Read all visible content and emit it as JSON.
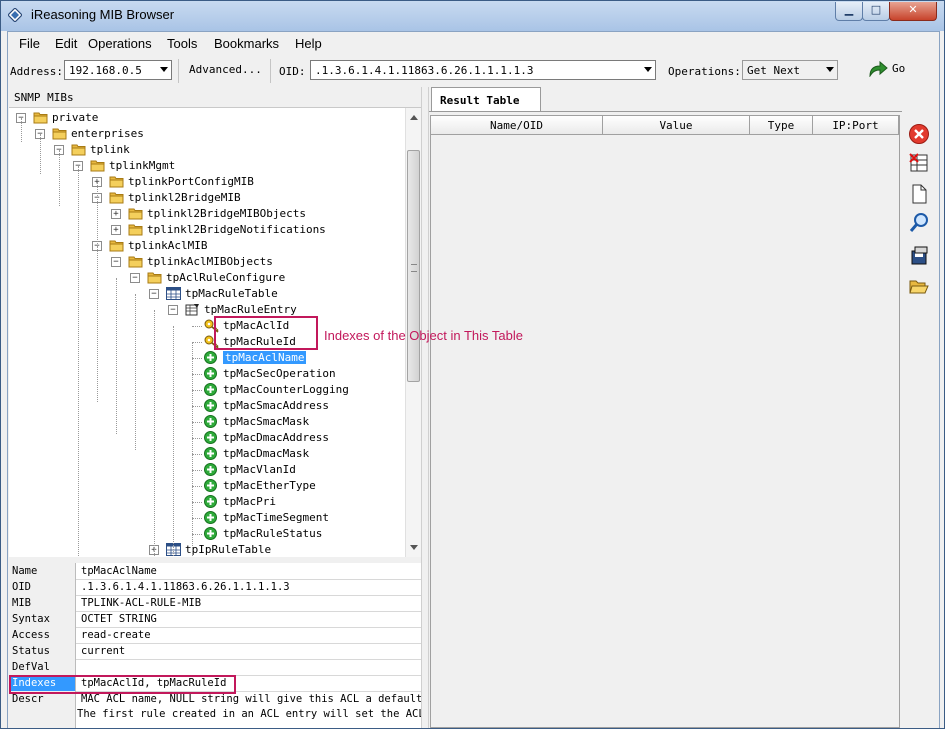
{
  "window": {
    "title": "iReasoning MIB Browser",
    "buttons": {
      "minimize": "▁",
      "maximize": "□",
      "close": "✕"
    }
  },
  "menu": [
    "File",
    "Edit",
    "Operations",
    "Tools",
    "Bookmarks",
    "Help"
  ],
  "toolbar": {
    "address_label": "Address:",
    "address_value": "192.168.0.5",
    "advanced_label": "Advanced...",
    "oid_label": "OID:",
    "oid_value": ".1.3.6.1.4.1.11863.6.26.1.1.1.1.3",
    "operations_label": "Operations:",
    "operations_value": "Get Next",
    "go_label": "Go"
  },
  "tree_panel": {
    "title": "SNMP MIBs",
    "nodes": [
      {
        "label": "private",
        "type": "folder",
        "expander": "−"
      },
      {
        "label": "enterprises",
        "type": "folder",
        "expander": "−"
      },
      {
        "label": "tplink",
        "type": "folder",
        "expander": "−"
      },
      {
        "label": "tplinkMgmt",
        "type": "folder",
        "expander": "−"
      },
      {
        "label": "tplinkPortConfigMIB",
        "type": "folder",
        "expander": "+"
      },
      {
        "label": "tplinkl2BridgeMIB",
        "type": "folder",
        "expander": "−"
      },
      {
        "label": "tplinkl2BridgeMIBObjects",
        "type": "folder",
        "expander": "+"
      },
      {
        "label": "tplinkl2BridgeNotifications",
        "type": "folder",
        "expander": "+"
      },
      {
        "label": "tplinkAclMIB",
        "type": "folder",
        "expander": "−"
      },
      {
        "label": "tplinkAclMIBObjects",
        "type": "folder",
        "expander": "−"
      },
      {
        "label": "tpAclRuleConfigure",
        "type": "folder",
        "expander": "−"
      },
      {
        "label": "tpMacRuleTable",
        "type": "table",
        "expander": "−"
      },
      {
        "label": "tpMacRuleEntry",
        "type": "entry",
        "expander": "−"
      },
      {
        "label": "tpMacAclId",
        "type": "key"
      },
      {
        "label": "tpMacRuleId",
        "type": "key"
      },
      {
        "label": "tpMacAclName",
        "type": "leaf",
        "selected": true
      },
      {
        "label": "tpMacSecOperation",
        "type": "leaf"
      },
      {
        "label": "tpMacCounterLogging",
        "type": "leaf"
      },
      {
        "label": "tpMacSmacAddress",
        "type": "leaf"
      },
      {
        "label": "tpMacSmacMask",
        "type": "leaf"
      },
      {
        "label": "tpMacDmacAddress",
        "type": "leaf"
      },
      {
        "label": "tpMacDmacMask",
        "type": "leaf"
      },
      {
        "label": "tpMacVlanId",
        "type": "leaf"
      },
      {
        "label": "tpMacEtherType",
        "type": "leaf"
      },
      {
        "label": "tpMacPri",
        "type": "leaf"
      },
      {
        "label": "tpMacTimeSegment",
        "type": "leaf"
      },
      {
        "label": "tpMacRuleStatus",
        "type": "leaf"
      },
      {
        "label": "tpIpRuleTable",
        "type": "table",
        "expander": "+"
      }
    ]
  },
  "properties": [
    {
      "key": "Name",
      "value": "tpMacAclName"
    },
    {
      "key": "OID",
      "value": ".1.3.6.1.4.1.11863.6.26.1.1.1.1.3"
    },
    {
      "key": "MIB",
      "value": "TPLINK-ACL-RULE-MIB"
    },
    {
      "key": "Syntax",
      "value": "OCTET STRING"
    },
    {
      "key": "Access",
      "value": "read-create"
    },
    {
      "key": "Status",
      "value": "current"
    },
    {
      "key": "DefVal",
      "value": ""
    },
    {
      "key": "Indexes",
      "value": "tpMacAclId, tpMacRuleId",
      "selected": true
    },
    {
      "key": "Descr",
      "value": " MAC ACL name, NULL string will give this ACL a default n",
      "value2": "The first rule created in an ACL entry will set the ACL n"
    }
  ],
  "result_tab": {
    "label": "Result Table",
    "columns": [
      "Name/OID",
      "Value",
      "Type",
      "IP:Port"
    ]
  },
  "annotation": {
    "text": "Indexes of the Object in This Table",
    "color": "#c2185b"
  },
  "colors": {
    "selection": "#3399ff",
    "folder": "#e8b840",
    "leaf": "#2eaa3a",
    "annotation": "#c2185b"
  }
}
